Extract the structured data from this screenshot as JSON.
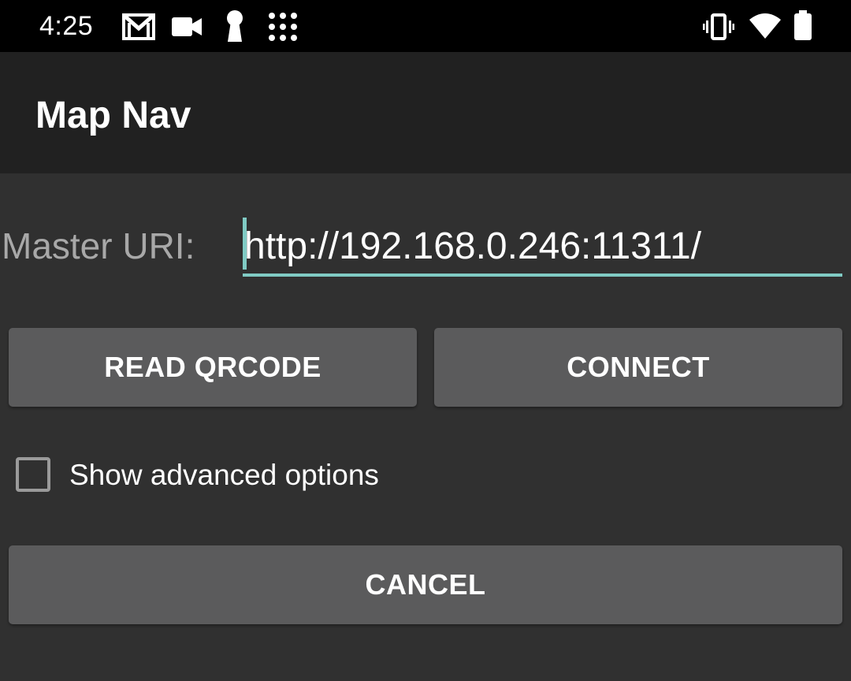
{
  "status_bar": {
    "time": "4:25",
    "left_icons": [
      "gmail-icon",
      "video-camera-icon",
      "keyhole-icon",
      "app-grid-icon"
    ],
    "right_icons": [
      "vibrate-icon",
      "wifi-icon",
      "battery-icon"
    ]
  },
  "app_bar": {
    "title": "Map Nav"
  },
  "form": {
    "master_uri_label": "Master URI:",
    "master_uri_value": "http://192.168.0.246:11311/",
    "read_qrcode_label": "READ QRCODE",
    "connect_label": "CONNECT",
    "show_advanced_label": "Show advanced options",
    "show_advanced_checked": false,
    "cancel_label": "CANCEL"
  },
  "colors": {
    "accent": "#80cbc4",
    "background": "#303030",
    "app_bar": "#212121",
    "status_bar": "#000000",
    "button": "#5b5b5c"
  }
}
